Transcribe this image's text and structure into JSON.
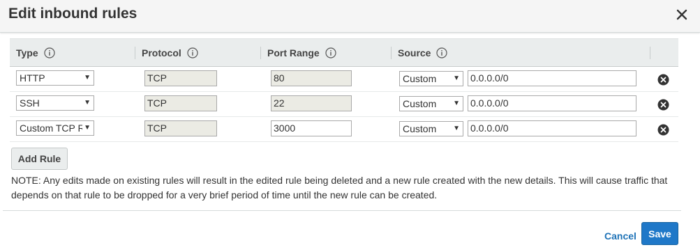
{
  "dialog": {
    "title": "Edit inbound rules"
  },
  "table": {
    "headers": {
      "type": "Type",
      "protocol": "Protocol",
      "port_range": "Port Range",
      "source": "Source"
    },
    "rows": [
      {
        "type": "HTTP",
        "protocol": "TCP",
        "port_range": "80",
        "source_type": "Custom",
        "cidr": "0.0.0.0/0"
      },
      {
        "type": "SSH",
        "protocol": "TCP",
        "port_range": "22",
        "source_type": "Custom",
        "cidr": "0.0.0.0/0"
      },
      {
        "type": "Custom TCP Rule",
        "protocol": "TCP",
        "port_range": "3000",
        "source_type": "Custom",
        "cidr": "0.0.0.0/0"
      }
    ]
  },
  "actions": {
    "add_rule": "Add Rule",
    "cancel": "Cancel",
    "save": "Save"
  },
  "note": "NOTE: Any edits made on existing rules will result in the edited rule being deleted and a new rule created with the new details. This will cause traffic that depends on that rule to be dropped for a very brief period of time until the new rule can be created.",
  "colors": {
    "primary": "#1f78c8",
    "link": "#1f73b7",
    "header_bg": "#eaeded",
    "readonly_bg": "#ebebe4"
  },
  "icons": {
    "close": "close-icon",
    "info": "info-icon",
    "remove": "remove-circle-icon",
    "dropdown": "chevron-down-icon"
  }
}
